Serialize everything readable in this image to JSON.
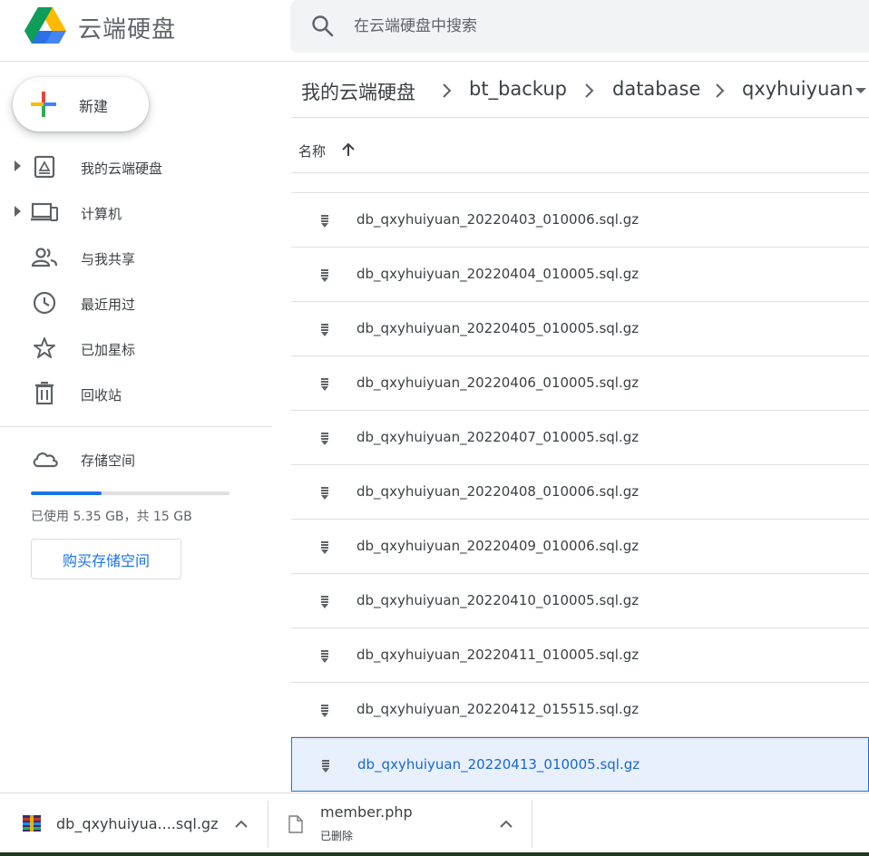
{
  "app": {
    "title": "云端硬盘"
  },
  "search": {
    "placeholder": "在云端硬盘中搜索"
  },
  "sidebar": {
    "new_label": "新建",
    "items": [
      {
        "label": "我的云端硬盘",
        "icon": "drive-icon",
        "expandable": true
      },
      {
        "label": "计算机",
        "icon": "computer-icon",
        "expandable": true
      },
      {
        "label": "与我共享",
        "icon": "people-icon",
        "expandable": false
      },
      {
        "label": "最近用过",
        "icon": "clock-icon",
        "expandable": false
      },
      {
        "label": "已加星标",
        "icon": "star-icon",
        "expandable": false
      },
      {
        "label": "回收站",
        "icon": "trash-icon",
        "expandable": false
      }
    ],
    "storage": {
      "label": "存储空间",
      "usage_text": "已使用 5.35 GB，共 15 GB",
      "used_fraction": 0.357,
      "buy_label": "购买存储空间"
    }
  },
  "breadcrumb": [
    "我的云端硬盘",
    "bt_backup",
    "database",
    "qxyhuiyuan"
  ],
  "list": {
    "column_name": "名称",
    "sort": "ascending",
    "files": [
      "db_qxyhuiyuan_20220403_010006.sql.gz",
      "db_qxyhuiyuan_20220404_010005.sql.gz",
      "db_qxyhuiyuan_20220405_010005.sql.gz",
      "db_qxyhuiyuan_20220406_010005.sql.gz",
      "db_qxyhuiyuan_20220407_010005.sql.gz",
      "db_qxyhuiyuan_20220408_010006.sql.gz",
      "db_qxyhuiyuan_20220409_010006.sql.gz",
      "db_qxyhuiyuan_20220410_010005.sql.gz",
      "db_qxyhuiyuan_20220411_010005.sql.gz",
      "db_qxyhuiyuan_20220412_015515.sql.gz",
      "db_qxyhuiyuan_20220413_010005.sql.gz"
    ],
    "selected_index": 10
  },
  "downloads": [
    {
      "name": "db_qxyhuiyua....sql.gz",
      "status": "",
      "icon": "archive-icon"
    },
    {
      "name": "member.php",
      "status": "已删除",
      "icon": "file-icon"
    }
  ],
  "colors": {
    "accent": "#1a73e8",
    "selected_bg": "#e8f0fe",
    "text": "#3c4043",
    "icon": "#5f6368"
  }
}
